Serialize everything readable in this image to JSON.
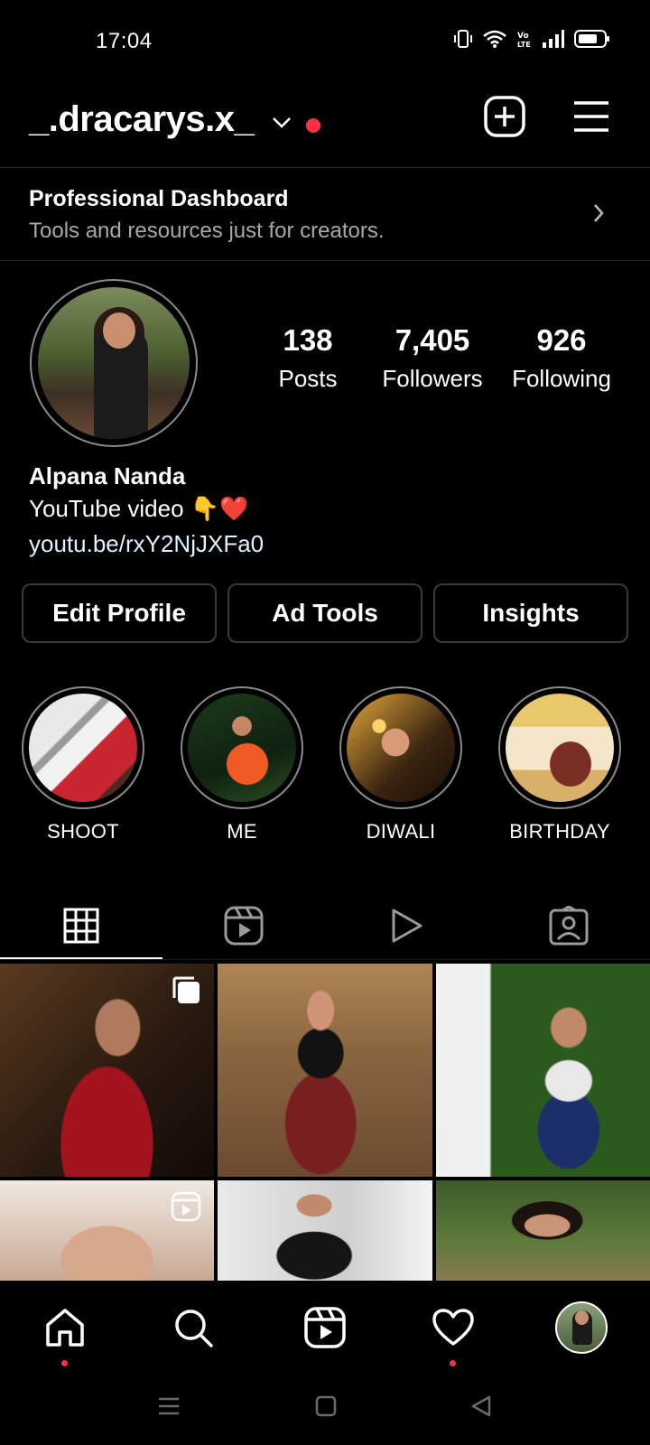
{
  "status_bar": {
    "time": "17:04"
  },
  "header": {
    "username": "_.dracarys.x_"
  },
  "dashboard": {
    "title": "Professional Dashboard",
    "subtitle": "Tools and resources just for creators."
  },
  "profile": {
    "stats": [
      {
        "value": "138",
        "label": "Posts"
      },
      {
        "value": "7,405",
        "label": "Followers"
      },
      {
        "value": "926",
        "label": "Following"
      }
    ],
    "name": "Alpana Nanda",
    "bio": "YouTube video 👇❤️",
    "link": "youtu.be/rxY2NjJXFa0"
  },
  "actions": {
    "edit_profile": "Edit Profile",
    "ad_tools": "Ad Tools",
    "insights": "Insights"
  },
  "highlights": [
    {
      "label": "SHOOT"
    },
    {
      "label": "ME"
    },
    {
      "label": "DIWALI"
    },
    {
      "label": "BIRTHDAY"
    }
  ],
  "tabs": [
    {
      "icon": "grid-icon",
      "active": true
    },
    {
      "icon": "reels-icon",
      "active": false
    },
    {
      "icon": "video-play-icon",
      "active": false
    },
    {
      "icon": "tagged-icon",
      "active": false
    }
  ],
  "bottom_nav": [
    {
      "icon": "home-icon",
      "has_dot": true
    },
    {
      "icon": "search-icon",
      "has_dot": false
    },
    {
      "icon": "reels-icon",
      "has_dot": false
    },
    {
      "icon": "heart-icon",
      "has_dot": true
    },
    {
      "icon": "profile-avatar-icon",
      "has_dot": false
    }
  ],
  "colors": {
    "background": "#000000",
    "notification": "#ff3040",
    "secondary_text": "#a8a8a8",
    "border": "#3a3a3a"
  }
}
